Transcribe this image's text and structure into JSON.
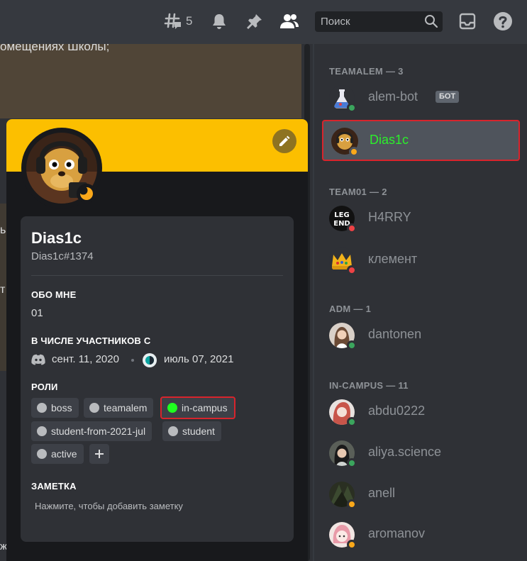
{
  "toolbar": {
    "threads_count": "5",
    "search_placeholder": "Поиск"
  },
  "chat": {
    "line1": "омещениях Школы;",
    "side_char1": "ь",
    "side_char2": "т",
    "bottom_line": "ж"
  },
  "profile": {
    "username": "Dias1c",
    "tag": "Dias1c#1374",
    "about_title": "ОБО МНЕ",
    "about_text": "01",
    "member_since_title": "В ЧИСЛЕ УЧАСТНИКОВ С",
    "discord_since": "сент. 11, 2020",
    "server_since": "июль 07, 2021",
    "roles_title": "РОЛИ",
    "roles": [
      "boss",
      "teamalem",
      "in-campus",
      "student-from-2021-jul",
      "student",
      "active"
    ],
    "note_title": "ЗАМЕТКА",
    "note_placeholder": "Нажмите, чтобы добавить заметку",
    "banner_color": "#fcbf00",
    "highlighted_role_color": "#1fff1f"
  },
  "members": {
    "groups": [
      {
        "title": "TEAMALEM — 3"
      },
      {
        "title": "TEAM01 — 2"
      },
      {
        "title": "ADM — 1"
      },
      {
        "title": "IN-CAMPUS — 11"
      }
    ],
    "items": [
      {
        "name": "alem-bot",
        "badge": "БОТ",
        "status": "online"
      },
      {
        "name": "Dias1c",
        "status": "idle",
        "selected": true
      },
      {
        "name": "H4RRY",
        "status": "dnd"
      },
      {
        "name": "клемент",
        "status": "dnd"
      },
      {
        "name": "dantonen",
        "status": "online"
      },
      {
        "name": "abdu0222",
        "status": "online"
      },
      {
        "name": "aliya.science",
        "status": "online"
      },
      {
        "name": "anell",
        "status": "idle"
      },
      {
        "name": "aromanov",
        "status": "idle"
      }
    ]
  }
}
